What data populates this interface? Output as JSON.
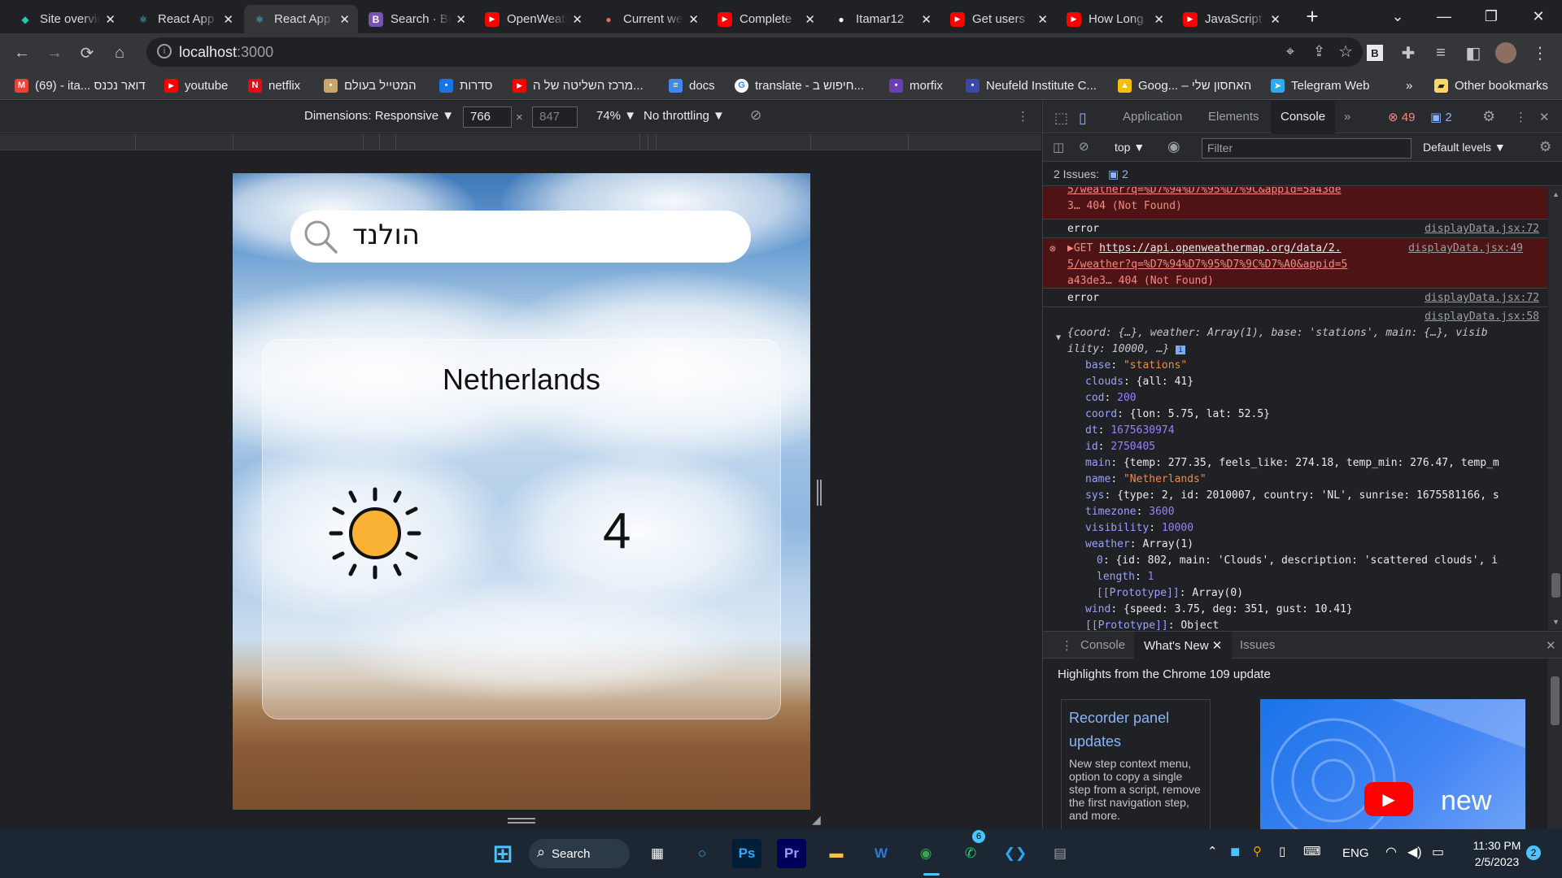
{
  "browser": {
    "tabs": [
      {
        "title": "Site overview",
        "icon": "netlify-icon",
        "color": "#25c7b7"
      },
      {
        "title": "React App",
        "icon": "react-icon",
        "color": "#61dafb"
      },
      {
        "title": "React App",
        "icon": "react-icon",
        "color": "#61dafb",
        "active": true
      },
      {
        "title": "Search · Bootstrap",
        "icon": "bootstrap-icon",
        "color": "#7952b3"
      },
      {
        "title": "OpenWeather",
        "icon": "youtube-icon",
        "color": "#ff0000"
      },
      {
        "title": "Current weather",
        "icon": "openweather-icon",
        "color": "#eb6e4b"
      },
      {
        "title": "Complete",
        "icon": "youtube-icon",
        "color": "#ff0000"
      },
      {
        "title": "Itamar12",
        "icon": "github-icon",
        "color": "#ffffff"
      },
      {
        "title": "Get users",
        "icon": "youtube-icon",
        "color": "#ff0000"
      },
      {
        "title": "How Long",
        "icon": "youtube-icon",
        "color": "#ff0000"
      },
      {
        "title": "JavaScript",
        "icon": "youtube-icon",
        "color": "#ff0000"
      }
    ],
    "url": "localhost",
    "url_port": ":3000",
    "bookmarks": [
      {
        "label": "(69) - ita... דואר נכנס",
        "icon": "gmail-icon",
        "color": "#ea4335"
      },
      {
        "label": "youtube",
        "icon": "youtube-icon",
        "color": "#ff0000"
      },
      {
        "label": "netflix",
        "icon": "netflix-icon",
        "color": "#e50914"
      },
      {
        "label": "המטייל בעולם",
        "icon": "site-icon",
        "color": "#c9a66b"
      },
      {
        "label": "סדרות",
        "icon": "site-icon",
        "color": "#1a73e8"
      },
      {
        "label": "מרכז השליטה של ה...",
        "icon": "youtube-icon",
        "color": "#ff0000"
      },
      {
        "label": "docs",
        "icon": "docs-icon",
        "color": "#4285f4"
      },
      {
        "label": "translate - חיפוש ב...",
        "icon": "google-icon",
        "color": "#ffffff"
      },
      {
        "label": "morfix",
        "icon": "morfix-icon",
        "color": "#6a3fb5"
      },
      {
        "label": "Neufeld Institute C...",
        "icon": "site-icon",
        "color": "#3949ab"
      },
      {
        "label": "Goog... – האחסון שלי",
        "icon": "drive-icon",
        "color": "#fbbc04"
      },
      {
        "label": "Telegram Web",
        "icon": "telegram-icon",
        "color": "#2aabee"
      }
    ],
    "bookmarks_more": "»",
    "other_bookmarks": "Other bookmarks"
  },
  "device_toolbar": {
    "dimensions_label": "Dimensions: Responsive ▼",
    "width": "766",
    "times": "×",
    "height_placeholder": "847",
    "zoom": "74% ▼",
    "throttling": "No throttling ▼"
  },
  "app": {
    "search_value": "הולנד",
    "city": "Netherlands",
    "temperature": "4",
    "weather_icon": "sun-icon"
  },
  "devtools": {
    "tabs": [
      "Application",
      "Elements",
      "Console"
    ],
    "active_tab": "Console",
    "more_tabs": "»",
    "errors_count": "49",
    "messages_count": "2",
    "context": "top ▼",
    "filter_placeholder": "Filter",
    "levels": "Default levels ▼",
    "issues_label": "2 Issues:",
    "issues_count": "2",
    "console_lines": [
      {
        "type": "error",
        "text": "5/weather?q=%D7%94%D7%95%D7%9C&appid=5a43de",
        "text2": "3… 404 (Not Found)"
      },
      {
        "type": "log",
        "text": "error",
        "source": "displayData.jsx:72"
      },
      {
        "type": "error-get",
        "method": "▶GET",
        "link": "https://api.openweathermap.org/data/2.",
        "text2": "5/weather?q=%D7%94%D7%95%D7%9C%D7%A0&appid=5",
        "text3": "a43de3… 404 (Not Found)",
        "source": "displayData.jsx:49"
      },
      {
        "type": "log",
        "text": "error",
        "source": "displayData.jsx:72"
      },
      {
        "type": "source",
        "source": "displayData.jsx:58"
      }
    ],
    "object_preview": "{coord: {…}, weather: Array(1), base: 'stations', main: {…}, visib",
    "object_preview2": "ility: 10000, …}",
    "object_props": [
      {
        "key": "base",
        "value": "\"stations\"",
        "vtype": "s",
        "expander": ""
      },
      {
        "key": "clouds",
        "value": "{all: 41}",
        "vtype": "plain",
        "expander": "▶"
      },
      {
        "key": "cod",
        "value": "200",
        "vtype": "n",
        "expander": ""
      },
      {
        "key": "coord",
        "value": "{lon: 5.75, lat: 52.5}",
        "vtype": "plain",
        "expander": "▶"
      },
      {
        "key": "dt",
        "value": "1675630974",
        "vtype": "n",
        "expander": ""
      },
      {
        "key": "id",
        "value": "2750405",
        "vtype": "n",
        "expander": ""
      },
      {
        "key": "main",
        "value": "{temp: 277.35, feels_like: 274.18, temp_min: 276.47, temp_m",
        "vtype": "plain",
        "expander": "▶"
      },
      {
        "key": "name",
        "value": "\"Netherlands\"",
        "vtype": "s",
        "expander": ""
      },
      {
        "key": "sys",
        "value": "{type: 2, id: 2010007, country: 'NL', sunrise: 1675581166, s",
        "vtype": "plain",
        "expander": "▶"
      },
      {
        "key": "timezone",
        "value": "3600",
        "vtype": "n",
        "expander": ""
      },
      {
        "key": "visibility",
        "value": "10000",
        "vtype": "n",
        "expander": ""
      },
      {
        "key": "weather",
        "value": "Array(1)",
        "vtype": "plain",
        "expander": "▼"
      },
      {
        "key": "0",
        "value": "{id: 802, main: 'Clouds', description: 'scattered clouds', i",
        "vtype": "plain",
        "expander": "▶",
        "indent": 1
      },
      {
        "key": "length",
        "value": "1",
        "vtype": "n",
        "expander": "",
        "indent": 1
      },
      {
        "key": "[[Prototype]]",
        "value": "Array(0)",
        "vtype": "plain",
        "expander": "▶",
        "indent": 1
      },
      {
        "key": "wind",
        "value": "{speed: 3.75, deg: 351, gust: 10.41}",
        "vtype": "plain",
        "expander": "▶"
      },
      {
        "key": "[[Prototype]]",
        "value": "Object",
        "vtype": "plain",
        "expander": "▶"
      }
    ],
    "drawer_tabs": [
      "Console",
      "What's New",
      "Issues"
    ],
    "drawer_active": "What's New",
    "whats_new_title": "Highlights from the Chrome 109 update",
    "card_title": "Recorder panel updates",
    "card_text": "New step context menu, option to copy a single step from a script, remove the first navigation step, and more.",
    "video_label": "new"
  },
  "taskbar": {
    "search_label": "Search",
    "language": "ENG",
    "time": "11:30 PM",
    "date": "2/5/2023",
    "notification_count": "2",
    "whatsapp_badge": "6",
    "apps": [
      {
        "name": "start-button",
        "glyph": "⊞",
        "color": "#4cc2ff"
      },
      {
        "name": "store-icon",
        "glyph": "▦",
        "color": "#ffffff"
      },
      {
        "name": "cortana-icon",
        "glyph": "○",
        "color": "#2aa8f2"
      },
      {
        "name": "photoshop-icon",
        "glyph": "Ps",
        "color": "#31a8ff"
      },
      {
        "name": "premiere-icon",
        "glyph": "Pr",
        "color": "#9999ff"
      },
      {
        "name": "file-explorer-icon",
        "glyph": "▬",
        "color": "#f5c24c"
      },
      {
        "name": "word-icon",
        "glyph": "W",
        "color": "#2b7cd3"
      },
      {
        "name": "chrome-icon",
        "glyph": "◉",
        "color": "#34a853"
      },
      {
        "name": "whatsapp-icon",
        "glyph": "✆",
        "color": "#25d366"
      },
      {
        "name": "vscode-icon",
        "glyph": "❮❯",
        "color": "#23a9f2"
      },
      {
        "name": "calculator-icon",
        "glyph": "▤",
        "color": "#9aa0a6"
      }
    ]
  }
}
